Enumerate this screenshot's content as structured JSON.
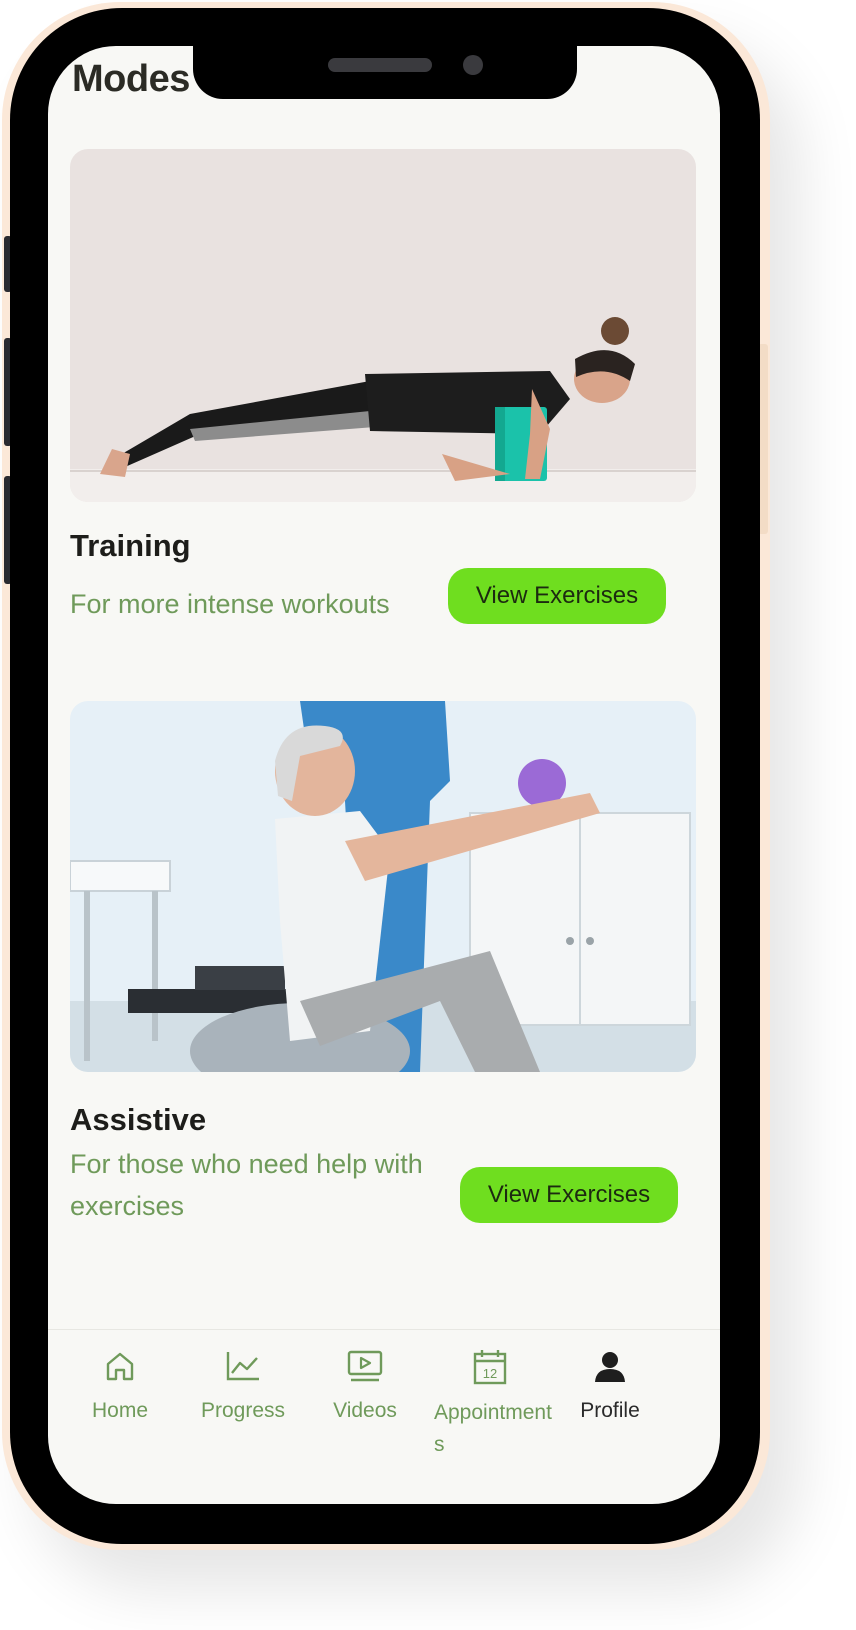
{
  "page": {
    "title": "Modes"
  },
  "cards": [
    {
      "title": "Training",
      "description": "For more intense workouts",
      "button_label": "View Exercises",
      "image_alt": "Woman doing a plank on a teal yoga block"
    },
    {
      "title": "Assistive",
      "description": "For those who need help with exercises",
      "button_label": "View Exercises",
      "image_alt": "Senior man on exercise ball with physiotherapist"
    }
  ],
  "tab_bar": {
    "items": [
      {
        "label": "Home",
        "icon": "home-icon",
        "active": false
      },
      {
        "label": "Progress",
        "icon": "chart-line-icon",
        "active": false
      },
      {
        "label": "Videos",
        "icon": "video-play-icon",
        "active": false
      },
      {
        "label": "Appointments",
        "icon": "calendar-icon",
        "active": false,
        "icon_text": "12"
      },
      {
        "label": "Profile",
        "icon": "person-icon",
        "active": true
      }
    ]
  },
  "colors": {
    "accent_button": "#6fde1f",
    "muted_green_text": "#6f9a5a",
    "screen_bg": "#f8f8f5"
  }
}
